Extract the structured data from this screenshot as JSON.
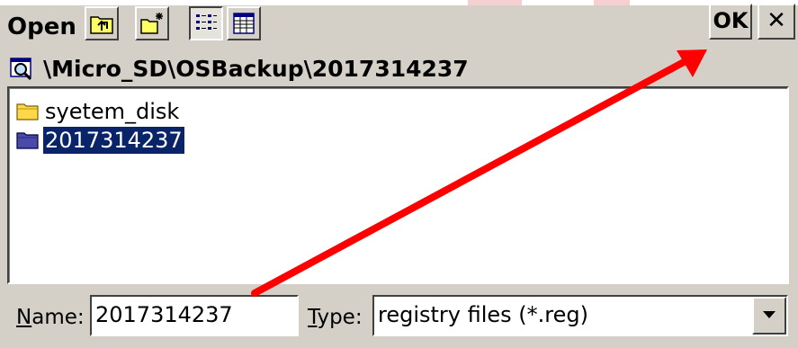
{
  "dialog": {
    "title": "Open",
    "ok_label": "OK",
    "close_label": "✕"
  },
  "toolbar": {
    "icons": [
      "up-folder-icon",
      "new-folder-icon",
      "list-view-icon",
      "details-view-icon"
    ]
  },
  "path": "\\Micro_SD\\OSBackup\\2017314237",
  "files": [
    {
      "name": "syetem_disk",
      "icon": "folder-icon"
    },
    {
      "name": "2017314237",
      "icon": "folder-icon",
      "selected": true
    }
  ],
  "name_field": {
    "label_first": "N",
    "label_rest": "ame:",
    "value": "2017314237"
  },
  "type_field": {
    "label_first": "T",
    "label_rest": "ype:",
    "value": "registry files (*.reg)"
  },
  "colors": {
    "selection": "#0a246a",
    "annotation_arrow": "#ff0000"
  }
}
